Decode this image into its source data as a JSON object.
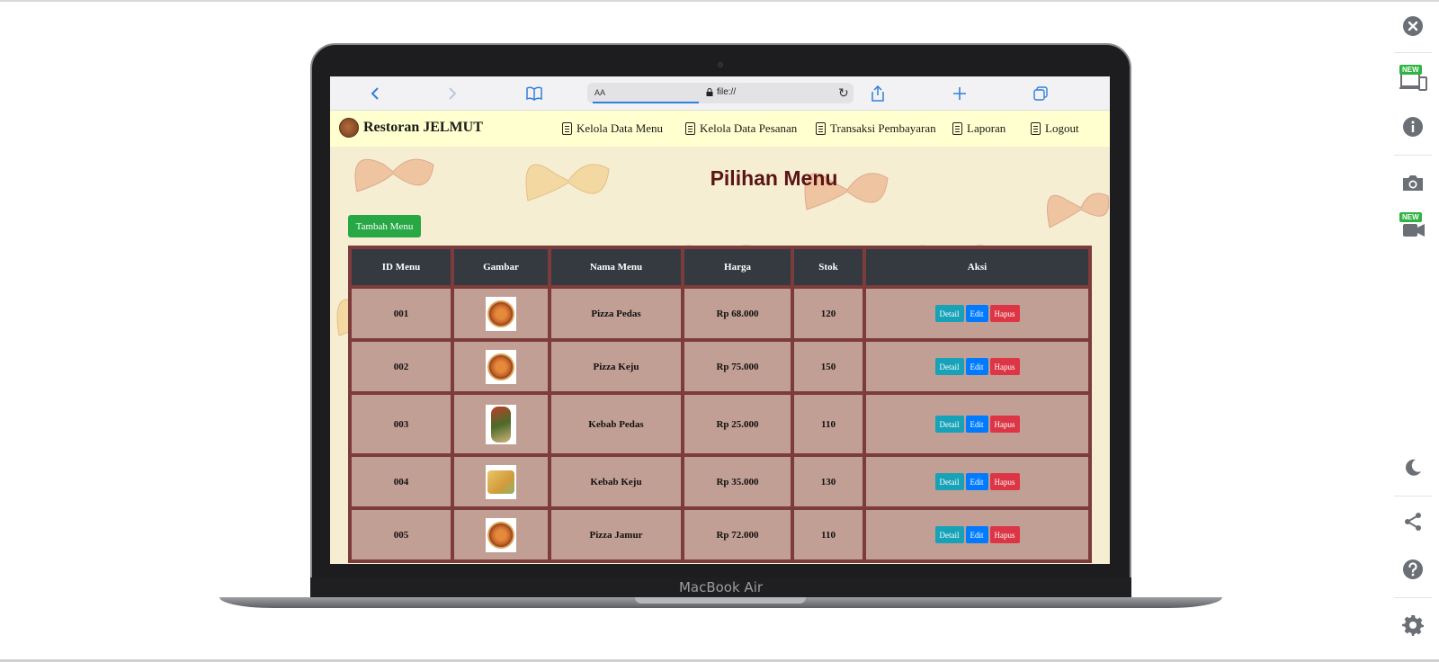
{
  "device": {
    "label": "MacBook Air"
  },
  "browser": {
    "aa": "AA",
    "url": "file://"
  },
  "navbar": {
    "brand": "Restoran JELMUT",
    "items": [
      {
        "label": "Kelola Data Menu",
        "icon": "clipboard-icon"
      },
      {
        "label": "Kelola Data Pesanan",
        "icon": "document-icon"
      },
      {
        "label": "Transaksi Pembayaran",
        "icon": "payment-icon"
      },
      {
        "label": "Laporan",
        "icon": "report-icon"
      },
      {
        "label": "Logout",
        "icon": "logout-icon"
      }
    ]
  },
  "page": {
    "title": "Pilihan Menu",
    "add_button": "Tambah Menu"
  },
  "table": {
    "headers": [
      "ID Menu",
      "Gambar",
      "Nama Menu",
      "Harga",
      "Stok",
      "Aksi"
    ],
    "rows": [
      {
        "id": "001",
        "image": "pizza",
        "name": "Pizza Pedas",
        "price": "Rp 68.000",
        "stock": "120"
      },
      {
        "id": "002",
        "image": "pizza",
        "name": "Pizza Keju",
        "price": "Rp 75.000",
        "stock": "150"
      },
      {
        "id": "003",
        "image": "kebab",
        "name": "Kebab Pedas",
        "price": "Rp 25.000",
        "stock": "110"
      },
      {
        "id": "004",
        "image": "kebab2",
        "name": "Kebab Keju",
        "price": "Rp 35.000",
        "stock": "130"
      },
      {
        "id": "005",
        "image": "pizza",
        "name": "Pizza Jamur",
        "price": "Rp 72.000",
        "stock": "110"
      }
    ],
    "actions": {
      "detail": "Detail",
      "edit": "Edit",
      "delete": "Hapus"
    }
  },
  "rail": {
    "new_badge": "NEW",
    "icons": [
      "close-icon",
      "responsive-devices-icon",
      "info-icon",
      "camera-icon",
      "video-icon",
      "moon-icon",
      "share-icon",
      "help-icon",
      "settings-icon"
    ]
  },
  "colors": {
    "navbar_bg": "#ffffcf",
    "title": "#5a1414",
    "table_border": "#7d3c3c",
    "table_header": "#343a40",
    "add_button": "#28a745",
    "detail": "#17a2b8",
    "edit": "#007bff",
    "delete": "#dc3545"
  }
}
